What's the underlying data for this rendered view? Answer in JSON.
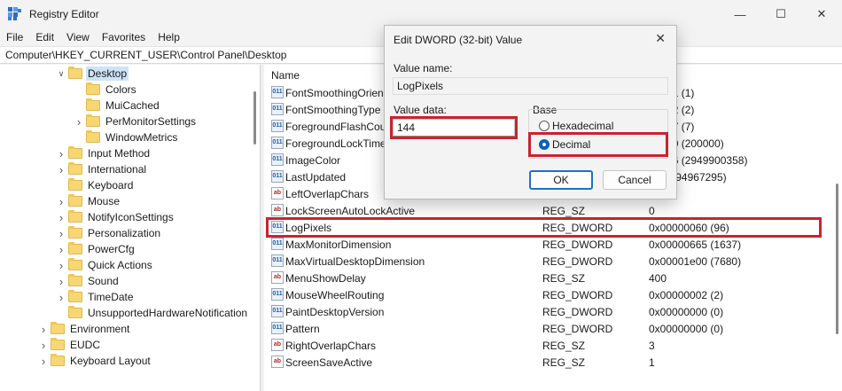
{
  "window": {
    "title": "Registry Editor",
    "controls": [
      "minimize-icon",
      "maximize-icon",
      "close-icon"
    ]
  },
  "menu": [
    "File",
    "Edit",
    "View",
    "Favorites",
    "Help"
  ],
  "address": "Computer\\HKEY_CURRENT_USER\\Control Panel\\Desktop",
  "tree": [
    {
      "label": "Desktop",
      "chevron": "expanded",
      "indent": 1,
      "selected": true
    },
    {
      "label": "Colors",
      "chevron": "none",
      "indent": 2
    },
    {
      "label": "MuiCached",
      "chevron": "none",
      "indent": 2
    },
    {
      "label": "PerMonitorSettings",
      "chevron": "collapsed",
      "indent": 2
    },
    {
      "label": "WindowMetrics",
      "chevron": "none",
      "indent": 2
    },
    {
      "label": "Input Method",
      "chevron": "collapsed",
      "indent": 1
    },
    {
      "label": "International",
      "chevron": "collapsed",
      "indent": 1
    },
    {
      "label": "Keyboard",
      "chevron": "none",
      "indent": 1
    },
    {
      "label": "Mouse",
      "chevron": "collapsed",
      "indent": 1
    },
    {
      "label": "NotifyIconSettings",
      "chevron": "collapsed",
      "indent": 1
    },
    {
      "label": "Personalization",
      "chevron": "collapsed",
      "indent": 1
    },
    {
      "label": "PowerCfg",
      "chevron": "collapsed",
      "indent": 1
    },
    {
      "label": "Quick Actions",
      "chevron": "collapsed",
      "indent": 1
    },
    {
      "label": "Sound",
      "chevron": "collapsed",
      "indent": 1
    },
    {
      "label": "TimeDate",
      "chevron": "collapsed",
      "indent": 1
    },
    {
      "label": "UnsupportedHardwareNotification",
      "chevron": "none",
      "indent": 1
    },
    {
      "label": "Environment",
      "chevron": "collapsed",
      "indent": 0
    },
    {
      "label": "EUDC",
      "chevron": "collapsed",
      "indent": 0
    },
    {
      "label": "Keyboard Layout",
      "chevron": "collapsed",
      "indent": 0
    }
  ],
  "columns": {
    "name": "Name"
  },
  "values": [
    {
      "name": "FontSmoothingOrien",
      "type": "",
      "data": "00001 (1)",
      "icon": "dword"
    },
    {
      "name": "FontSmoothingType",
      "type": "",
      "data": "00002 (2)",
      "icon": "dword"
    },
    {
      "name": "ForegroundFlashCou",
      "type": "",
      "data": "00007 (7)",
      "icon": "dword"
    },
    {
      "name": "ForegroundLockTime",
      "type": "",
      "data": "30d40 (200000)",
      "icon": "dword"
    },
    {
      "name": "ImageColor",
      "type": "",
      "data": "3e846 (2949900358)",
      "icon": "dword"
    },
    {
      "name": "LastUpdated",
      "type": "",
      "data": "fff (4294967295)",
      "icon": "dword"
    },
    {
      "name": "LeftOverlapChars",
      "type": "",
      "data": "",
      "icon": "sz"
    },
    {
      "name": "LockScreenAutoLockActive",
      "type": "REG_SZ",
      "data": "0",
      "icon": "sz"
    },
    {
      "name": "LogPixels",
      "type": "REG_DWORD",
      "data": "0x00000060 (96)",
      "icon": "dword",
      "highlighted": true
    },
    {
      "name": "MaxMonitorDimension",
      "type": "REG_DWORD",
      "data": "0x00000665 (1637)",
      "icon": "dword"
    },
    {
      "name": "MaxVirtualDesktopDimension",
      "type": "REG_DWORD",
      "data": "0x00001e00 (7680)",
      "icon": "dword"
    },
    {
      "name": "MenuShowDelay",
      "type": "REG_SZ",
      "data": "400",
      "icon": "sz"
    },
    {
      "name": "MouseWheelRouting",
      "type": "REG_DWORD",
      "data": "0x00000002 (2)",
      "icon": "dword"
    },
    {
      "name": "PaintDesktopVersion",
      "type": "REG_DWORD",
      "data": "0x00000000 (0)",
      "icon": "dword"
    },
    {
      "name": "Pattern",
      "type": "REG_DWORD",
      "data": "0x00000000 (0)",
      "icon": "dword"
    },
    {
      "name": "RightOverlapChars",
      "type": "REG_SZ",
      "data": "3",
      "icon": "sz"
    },
    {
      "name": "ScreenSaveActive",
      "type": "REG_SZ",
      "data": "1",
      "icon": "sz"
    }
  ],
  "dialog": {
    "title": "Edit DWORD (32-bit) Value",
    "value_name_label": "Value name:",
    "value_name": "LogPixels",
    "value_data_label": "Value data:",
    "value_data": "144",
    "base_label": "Base",
    "hex_label": "Hexadecimal",
    "dec_label": "Decimal",
    "selected_base": "Decimal",
    "ok": "OK",
    "cancel": "Cancel"
  },
  "colors": {
    "highlight_red": "#c8242f",
    "selection": "#cce4f7",
    "primary_border": "#1f6fd1"
  }
}
